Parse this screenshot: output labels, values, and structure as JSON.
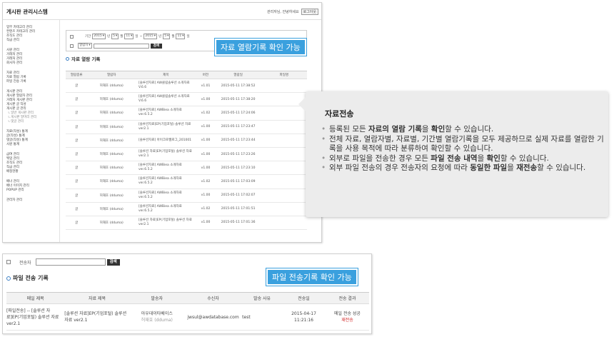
{
  "app": {
    "title": "게시판 관리시스템",
    "top_links": "관리자님, 안녕하세요",
    "logout": "로그아웃"
  },
  "sidebar": [
    [
      "업무 카테고리 관리",
      "컨텐츠 카테고리 관리",
      "조직도 관리",
      "직급 관리"
    ],
    [
      "사원 관리",
      "거래처 관리",
      "거래처 관리",
      "회사자 관리"
    ],
    [
      "자료 관리",
      "자료 열람 기록",
      "파일 전송 기록"
    ],
    [
      "게시판 관리",
      "게시판 열람자 관리",
      "거래처 게시판 관리",
      "게시판 글 작성",
      "게시판 글 관리"
    ],
    [
      "ㄴ일반 게시판 관리",
      "ㄴ게시판 말머리 관리",
      "ㄴ댓글 관리"
    ],
    [
      "자료(작성) 통계",
      "글(작성) 통계",
      "댓글(작성) 통계",
      "사원 통계"
    ],
    [
      "급여 관리",
      "백업 관리",
      "조직도 관리",
      "직급 관리",
      "배정현황"
    ],
    [
      "배너 관리",
      "배너 이미지 관리",
      "POPUP 관리"
    ],
    [
      "관리자 관리"
    ]
  ],
  "filter1": {
    "period_label": "기간",
    "y1": "2015",
    "m1": "5",
    "d1": "11",
    "y2": "2015",
    "m2": "5",
    "d2": "11",
    "year_unit": "년",
    "month_unit": "월",
    "day_unit": "일",
    "range_sep": "~",
    "field_select": "열람자",
    "search": "검색"
  },
  "section1": {
    "title": "자료 열람 기록",
    "headers": [
      "열람종류",
      "열람자",
      "제목",
      "버전",
      "열람일",
      "파일명"
    ]
  },
  "rows1": [
    {
      "kind": "글",
      "viewer": "허재호 (dduma)",
      "title": "[솔루션자료] AW클립솔루션 소개자료 V.6.6",
      "ver": "v1.01",
      "date": "2015-05-11 17:38:52",
      "file": ""
    },
    {
      "kind": "글",
      "viewer": "허재호 (dduma)",
      "title": "[솔루션자료] AW클립솔루션 소개자료 V.6.6",
      "ver": "v1.00",
      "date": "2015-05-11 17:38:20",
      "file": ""
    },
    {
      "kind": "글",
      "viewer": "허재호 (dduma)",
      "title": "[솔루션자료] AWBiea 소개자료 ver.6.5.2",
      "ver": "v1.02",
      "date": "2015-05-11 17:24:06",
      "file": ""
    },
    {
      "kind": "글",
      "viewer": "허재호 (dduma)",
      "title": "[솔루션자료]EP(기업포털) 솔루션 자료 ver2.1",
      "ver": "v1.00",
      "date": "2015-05-11 17:23:47",
      "file": ""
    },
    {
      "kind": "글",
      "viewer": "허재호 (dduma)",
      "title": "[솔루션자료] 아이크로웹로그_201001",
      "ver": "v1.00",
      "date": "2015-05-11 17:23:44",
      "file": ""
    },
    {
      "kind": "글",
      "viewer": "허재호 (dduma)",
      "title": "[솔루션 자료]EP(기업포털) 솔루션 자료 ver2.1",
      "ver": "v1.00",
      "date": "2015-05-11 17:23:26",
      "file": ""
    },
    {
      "kind": "글",
      "viewer": "허재호 (dduma)",
      "title": "[솔루션자료] AWBiea 소개자료 ver.6.5.2",
      "ver": "v1.00",
      "date": "2015-05-11 17:23:10",
      "file": ""
    },
    {
      "kind": "글",
      "viewer": "허재호 (dduma)",
      "title": "[솔루션자료] AWBiea 소개자료 ver.6.5.2",
      "ver": "v1.02",
      "date": "2015-05-11 17:03:09",
      "file": ""
    },
    {
      "kind": "글",
      "viewer": "허재호 (dduma)",
      "title": "[솔루션자료] AWBiea 소개자료 ver.6.5.2",
      "ver": "v1.00",
      "date": "2015-05-11 17:02:07",
      "file": ""
    },
    {
      "kind": "글",
      "viewer": "허재호 (dduma)",
      "title": "[솔루션자료] AWBiea 소개자료 ver.6.5.2",
      "ver": "v1.02",
      "date": "2015-05-11 17:01:51",
      "file": ""
    },
    {
      "kind": "글",
      "viewer": "허재호 (dduma)",
      "title": "[솔루션 자료]EP(기업포털) 솔루션 자료 ver2.1",
      "ver": "v1.00",
      "date": "2015-05-11 17:01:36",
      "file": ""
    }
  ],
  "callout1": "자료 열람기록 확인 가능",
  "tooltip": {
    "title": "자료전송",
    "bullets": [
      [
        [
          "등록된 모든 ",
          0
        ],
        [
          "자료의 열람 기록",
          1
        ],
        [
          "을 ",
          0
        ],
        [
          "확인",
          1
        ],
        [
          "할 수 있습니다.",
          0
        ]
      ],
      [
        [
          "전체 자료, 열람자별, 자료별, 기간별 열람기록을 모두 제공하므로 실제 자료를 열람한 기록을 사용 목적에 따라 분류하여 확인할 수 있습니다.",
          0
        ]
      ],
      [
        [
          "외부로 파일을 전송한 경우 모든 ",
          0
        ],
        [
          "파일 전송 내역",
          1
        ],
        [
          "을 ",
          0
        ],
        [
          "확인",
          1
        ],
        [
          "할 수 있습니다.",
          0
        ]
      ],
      [
        [
          "외부 파일 전송의 경우 전송자의 요청에 따라 ",
          0
        ],
        [
          "동일한 파일",
          1
        ],
        [
          "을 ",
          0
        ],
        [
          "재전송",
          1
        ],
        [
          "할 수 있습니다.",
          0
        ]
      ]
    ]
  },
  "filter2": {
    "label": "전송자",
    "search": "검색"
  },
  "section2": {
    "title": "파일 전송 기록",
    "headers": [
      "메일 제목",
      "자료 제목",
      "발송자",
      "수신자",
      "발송 사유",
      "전송일",
      "전송 결과"
    ]
  },
  "rows2": [
    {
      "mail": "[파일전송] -- [솔루션 자료]EP(기업포털) 솔루션 자료 ver2.1",
      "doc": "[솔루션 자료]EP(기업포털) 솔루션 자료 ver2.1",
      "sender": "아우데이타베이스",
      "sender_sub": "허재호 (dduma)",
      "receiver": "jwsul@awdatabase.com",
      "reason": "test",
      "date": "2015-04-17",
      "time": "11:21:16",
      "result": "메일 전송 성공",
      "resend": "재전송"
    }
  ],
  "callout2": "파일 전송기록 확인 가능",
  "colors": {
    "accent": "#3aa0de",
    "tooltip_bg": "#ececec",
    "resend": "#d02020"
  }
}
